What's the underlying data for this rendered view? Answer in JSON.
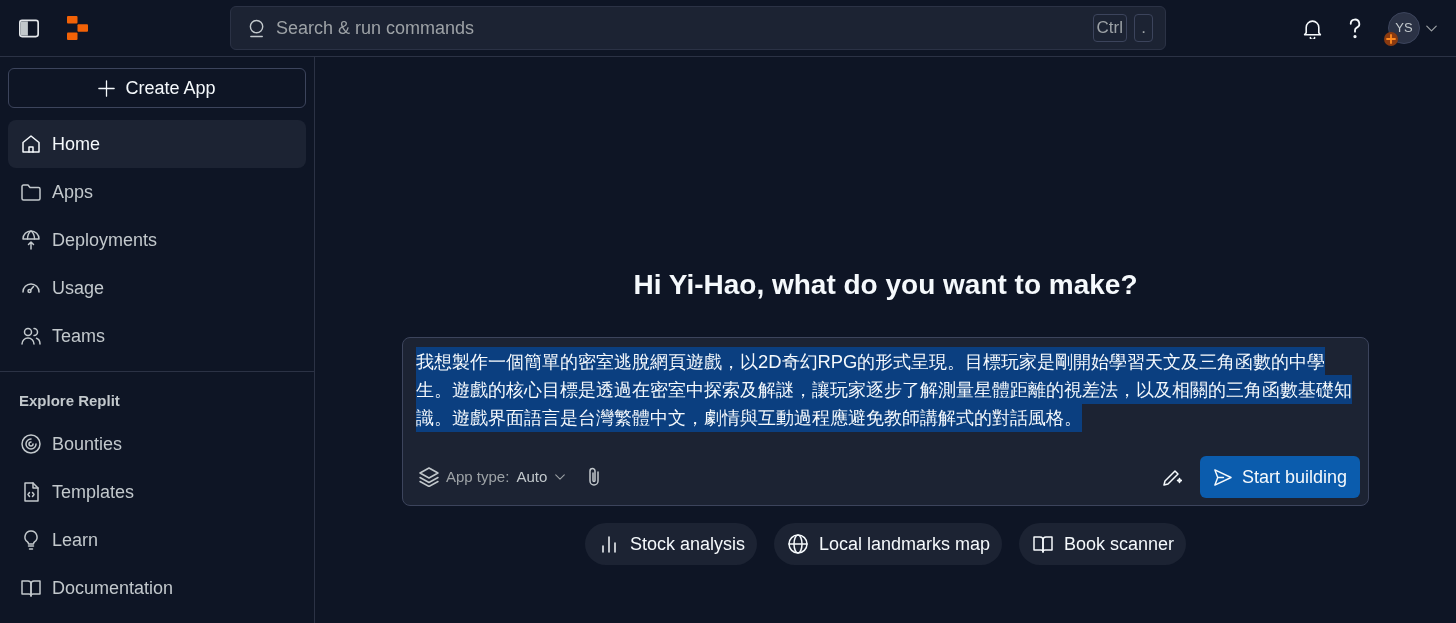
{
  "top_bar": {
    "search": {
      "placeholder": "Search & run commands",
      "shortcut_keys": [
        "Ctrl",
        "."
      ]
    },
    "avatar": {
      "initials": "YS"
    }
  },
  "sidebar": {
    "create_button": "Create App",
    "items": [
      {
        "label": "Home",
        "selected": true
      },
      {
        "label": "Apps",
        "selected": false
      },
      {
        "label": "Deployments",
        "selected": false
      },
      {
        "label": "Usage",
        "selected": false
      },
      {
        "label": "Teams",
        "selected": false
      }
    ],
    "section_title": "Explore Replit",
    "explore_items": [
      {
        "label": "Bounties",
        "selected": false
      },
      {
        "label": "Templates",
        "selected": false
      },
      {
        "label": "Learn",
        "selected": false
      },
      {
        "label": "Documentation",
        "selected": false
      }
    ]
  },
  "main": {
    "greeting": "Hi Yi-Hao, what do you want to make?",
    "prompt": {
      "value": "我想製作一個簡單的密室逃脫網頁遊戲，以2D奇幻RPG的形式呈現。目標玩家是剛開始學習天文及三角函數的中學生。遊戲的核心目標是透過在密室中探索及解謎，讓玩家逐步了解測量星體距離的視差法，以及相關的三角函數基礎知識。遊戲界面語言是台灣繁體中文，劇情與互動過程應避免教師講解式的對話風格。",
      "highlighted": true,
      "app_type_label": "App type:",
      "app_type_value": "Auto",
      "submit_button": "Start building"
    },
    "suggestions": [
      "Stock analysis",
      "Local landmarks map",
      "Book scanner"
    ]
  }
}
